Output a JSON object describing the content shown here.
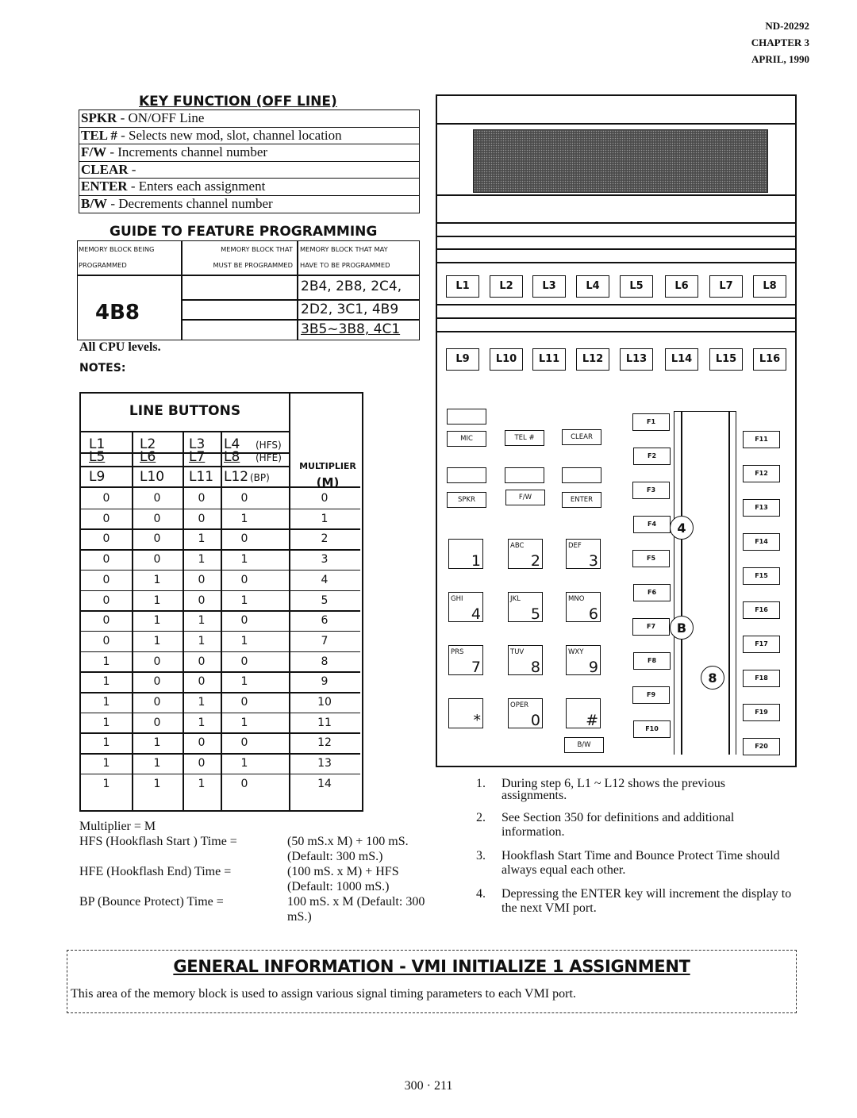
{
  "header": {
    "doc_id": "ND-20292",
    "chapter": "CHAPTER 3",
    "date": "APRIL, 1990"
  },
  "key_function": {
    "title": "KEY FUNCTION (OFF LINE)",
    "rows": [
      {
        "key": "SPKR",
        "desc": " - ON/OFF Line"
      },
      {
        "key": "TEL #",
        "desc": " - Selects new mod, slot, channel location"
      },
      {
        "key": "F/W",
        "desc": " -  Increments channel number"
      },
      {
        "key": "CLEAR",
        "desc": " -"
      },
      {
        "key": "ENTER",
        "desc": " - Enters each assignment"
      },
      {
        "key": "B/W",
        "desc": " -  Decrements channel number"
      }
    ]
  },
  "guide": {
    "title": "GUIDE TO FEATURE PROGRAMMING",
    "col1_l1": "MEMORY BLOCK BEING",
    "col1_l2": "PROGRAMMED",
    "col2_l1": "MEMORY BLOCK THAT",
    "col2_l2": "MUST BE PROGRAMMED",
    "col3_l1": "MEMORY BLOCK THAT MAY",
    "col3_l2": "HAVE TO BE PROGRAMMED",
    "block": "4B8",
    "may_rows": [
      "2B4, 2B8, 2C4,",
      "2D2, 3C1, 4B9",
      "3B5~3B8, 4C1"
    ]
  },
  "cpu_levels": "All CPU levels.",
  "notes_label": "NOTES:",
  "line_buttons": {
    "title": "LINE BUTTONS",
    "label_rows": [
      [
        "L1",
        "L2",
        "L3",
        "L4",
        "(HFS)"
      ],
      [
        "L5",
        "L6",
        "L7",
        "L8",
        "(HFE)"
      ],
      [
        "L9",
        "L10",
        "L11",
        "L12",
        "(BP)"
      ]
    ],
    "multiplier_l1": "MULTIPLIER",
    "multiplier_l2": "(M)",
    "rows": [
      [
        "0",
        "0",
        "0",
        "0",
        "0"
      ],
      [
        "0",
        "0",
        "0",
        "1",
        "1"
      ],
      [
        "0",
        "0",
        "1",
        "0",
        "2"
      ],
      [
        "0",
        "0",
        "1",
        "1",
        "3"
      ],
      [
        "0",
        "1",
        "0",
        "0",
        "4"
      ],
      [
        "0",
        "1",
        "0",
        "1",
        "5"
      ],
      [
        "0",
        "1",
        "1",
        "0",
        "6"
      ],
      [
        "0",
        "1",
        "1",
        "1",
        "7"
      ],
      [
        "1",
        "0",
        "0",
        "0",
        "8"
      ],
      [
        "1",
        "0",
        "0",
        "1",
        "9"
      ],
      [
        "1",
        "0",
        "1",
        "0",
        "10"
      ],
      [
        "1",
        "0",
        "1",
        "1",
        "11"
      ],
      [
        "1",
        "1",
        "0",
        "0",
        "12"
      ],
      [
        "1",
        "1",
        "0",
        "1",
        "13"
      ],
      [
        "1",
        "1",
        "1",
        "0",
        "14"
      ]
    ]
  },
  "formulas": {
    "multiplier": "Multiplier = M",
    "hfs_label": "HFS (Hookflash Start ) Time =",
    "hfs_value": "(50 mS.x M) + 100 mS.",
    "hfs_default": "(Default: 300 mS.)",
    "hfe_label": "HFE (Hookflash End) Time =",
    "hfe_value": "(100 mS. x M) + HFS",
    "hfe_default": "(Default:  1000 mS.)",
    "bp_label": "BP (Bounce Protect) Time =",
    "bp_value": "100 mS. x M  (Default:  300",
    "bp_value2": "mS.)"
  },
  "phone": {
    "line_keys_row1": [
      "L1",
      "L2",
      "L3",
      "L4",
      "L5",
      "L6",
      "L7",
      "L8"
    ],
    "line_keys_row2": [
      "L9",
      "L10",
      "L11",
      "L12",
      "L13",
      "L14",
      "L15",
      "L16"
    ],
    "soft_keys": [
      "MIC",
      "TEL #",
      "CLEAR",
      "SPKR",
      "F/W",
      "ENTER",
      "B/W"
    ],
    "dial_keys": [
      {
        "letters": "",
        "digit": "1"
      },
      {
        "letters": "ABC",
        "digit": "2"
      },
      {
        "letters": "DEF",
        "digit": "3"
      },
      {
        "letters": "GHI",
        "digit": "4"
      },
      {
        "letters": "JKL",
        "digit": "5"
      },
      {
        "letters": "MNO",
        "digit": "6"
      },
      {
        "letters": "PRS",
        "digit": "7"
      },
      {
        "letters": "TUV",
        "digit": "8"
      },
      {
        "letters": "WXY",
        "digit": "9"
      },
      {
        "letters": "",
        "digit": "*"
      },
      {
        "letters": "OPER",
        "digit": "0"
      },
      {
        "letters": "",
        "digit": "#"
      }
    ],
    "f_keys_left": [
      "F1",
      "F2",
      "F3",
      "F4",
      "F5",
      "F6",
      "F7",
      "F8",
      "F9",
      "F10"
    ],
    "f_keys_right": [
      "F11",
      "F12",
      "F13",
      "F14",
      "F15",
      "F16",
      "F17",
      "F18",
      "F19",
      "F20"
    ],
    "callouts": [
      "4",
      "B",
      "8"
    ]
  },
  "notes": [
    {
      "n": "1.",
      "text": "During step 6, L1 ~ L12 shows the previous assignments."
    },
    {
      "n": "2.",
      "text": "See Section 350 for definitions and additional information."
    },
    {
      "n": "3.",
      "text": "Hookflash Start Time and Bounce Protect Time should always equal each other."
    },
    {
      "n": "4.",
      "text": "Depressing the ENTER key will increment the display to the next VMI port."
    }
  ],
  "general": {
    "title": "GENERAL INFORMATION  -  VMI  INITIALIZE  1  ASSIGNMENT",
    "text": "This area of the memory block is used to assign various signal timing parameters to each VMI port."
  },
  "page_number": "300 · 211"
}
